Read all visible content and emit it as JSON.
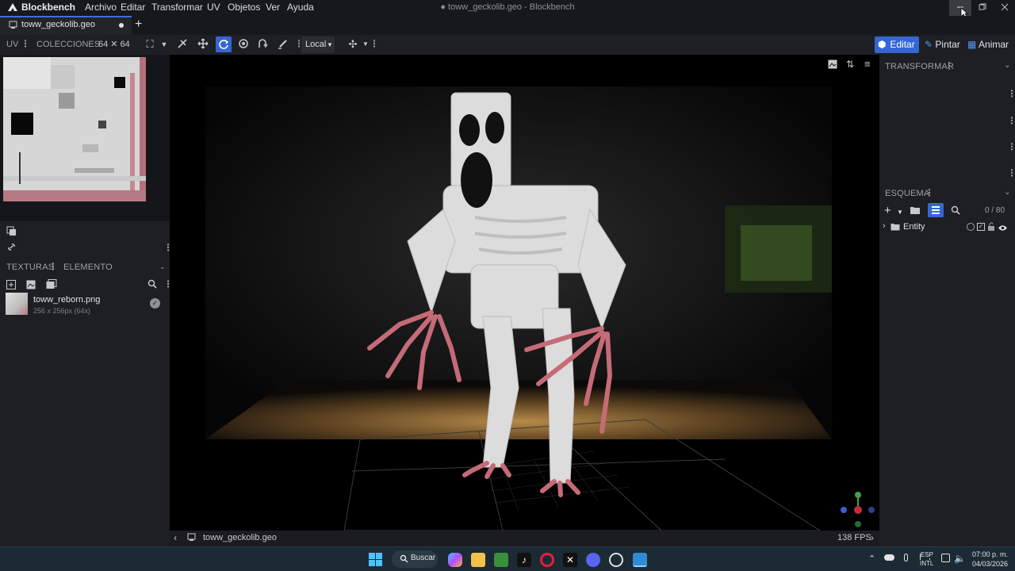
{
  "app": {
    "name": "Blockbench",
    "window_title": "● toww_geckolib.geo - Blockbench",
    "menu": [
      "Archivo",
      "Editar",
      "Transformar",
      "UV",
      "Objetos",
      "Ver",
      "Ayuda"
    ]
  },
  "tab": {
    "label": "toww_geckolib.geo"
  },
  "toolbar": {
    "uv_label": "UV",
    "collections_label": "COLECCIONES",
    "size_label": "64 ✕ 64",
    "space_select": "Local",
    "modes": [
      "Editar",
      "Pintar",
      "Animar"
    ],
    "active_mode": "Editar"
  },
  "left": {
    "textures_tab": "TEXTURAS",
    "element_tab": "ELEMENTO",
    "texture": {
      "name": "toww_reborn.png",
      "info": "256 x 256px (64x)"
    }
  },
  "right": {
    "transform_title": "TRANSFORMAR",
    "outliner_title": "ESQUEMA",
    "count": "0 / 80",
    "tree": [
      {
        "label": "Entity"
      }
    ]
  },
  "viewport": {
    "filename": "toww_geckolib.geo",
    "fps": "138 FPS"
  },
  "taskbar": {
    "search_label": "Buscar",
    "lang_top": "ESP",
    "lang_bottom": "INTL",
    "time": "07:00 p. m.",
    "date": "04/03/2026"
  },
  "colors": {
    "accent": "#3d6fd8",
    "editar_bg": "#3566d3"
  }
}
